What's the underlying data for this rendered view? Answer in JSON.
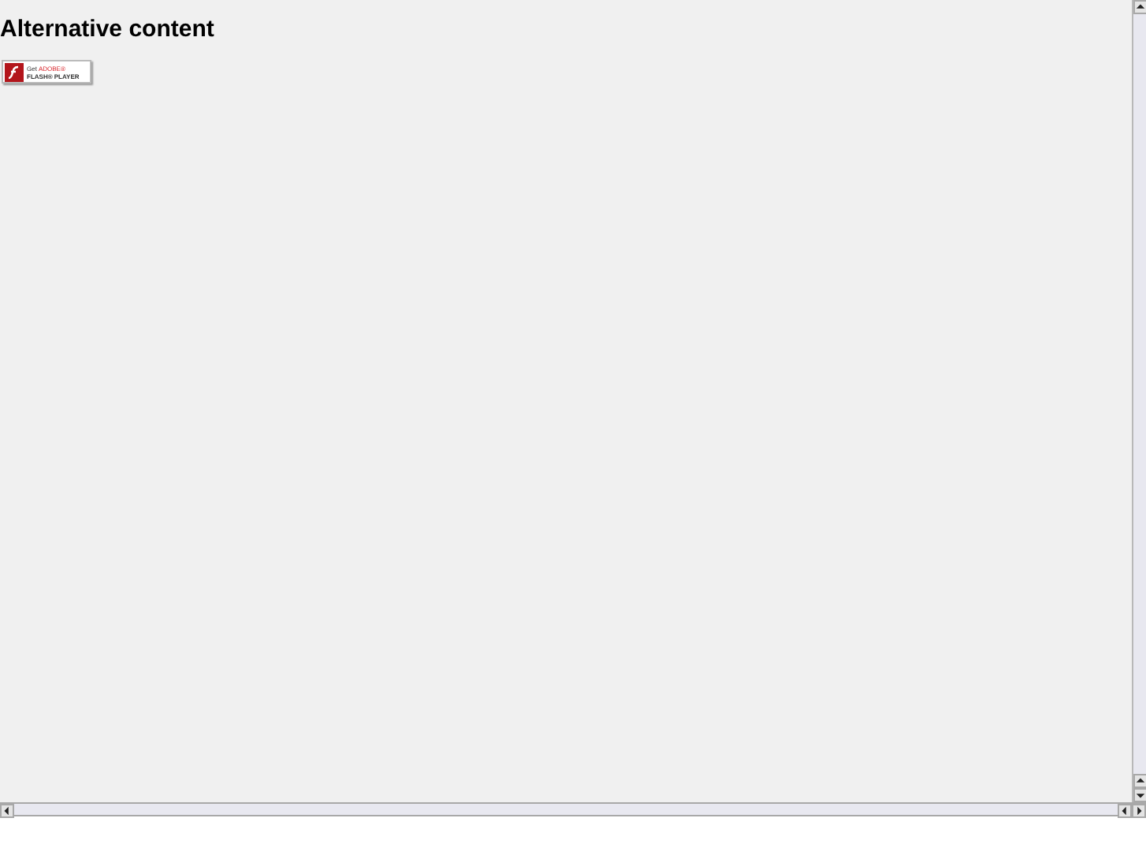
{
  "heading": "Alternative content",
  "badge": {
    "get": "Get",
    "brand": "ADOBE®",
    "product": "FLASH® PLAYER"
  }
}
